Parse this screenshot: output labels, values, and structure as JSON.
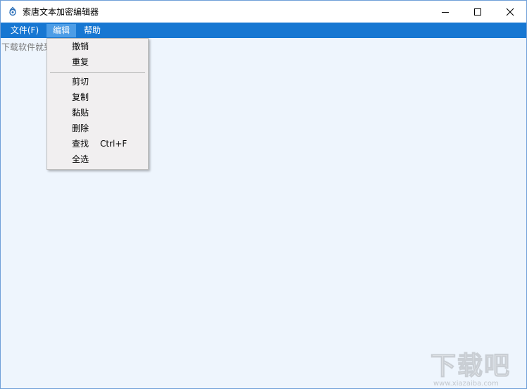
{
  "window": {
    "title": "索唐文本加密编辑器",
    "app_icon": "app-icon",
    "controls": [
      "minimize-icon",
      "maximize-icon",
      "close-icon"
    ]
  },
  "menubar": {
    "items": [
      "文件(F)",
      "编辑",
      "帮助"
    ],
    "active_index": 1
  },
  "editor": {
    "text": "下载软件就到"
  },
  "dropdown": {
    "items": [
      {
        "label": "撤销",
        "shortcut": ""
      },
      {
        "label": "重复",
        "shortcut": ""
      },
      {
        "label": "剪切",
        "shortcut": ""
      },
      {
        "label": "复制",
        "shortcut": ""
      },
      {
        "label": "黏贴",
        "shortcut": ""
      },
      {
        "label": "删除",
        "shortcut": ""
      },
      {
        "label": "查找",
        "shortcut": "Ctrl+F"
      },
      {
        "label": "全选",
        "shortcut": ""
      }
    ]
  },
  "watermark": {
    "text": "下载吧",
    "url": "www.xiazaiba.com"
  },
  "colors": {
    "menubar": "#1777d2",
    "menu_active": "#4d9de6",
    "editor_bg": "#eef5fd",
    "dropdown_bg": "#f1eff0"
  }
}
